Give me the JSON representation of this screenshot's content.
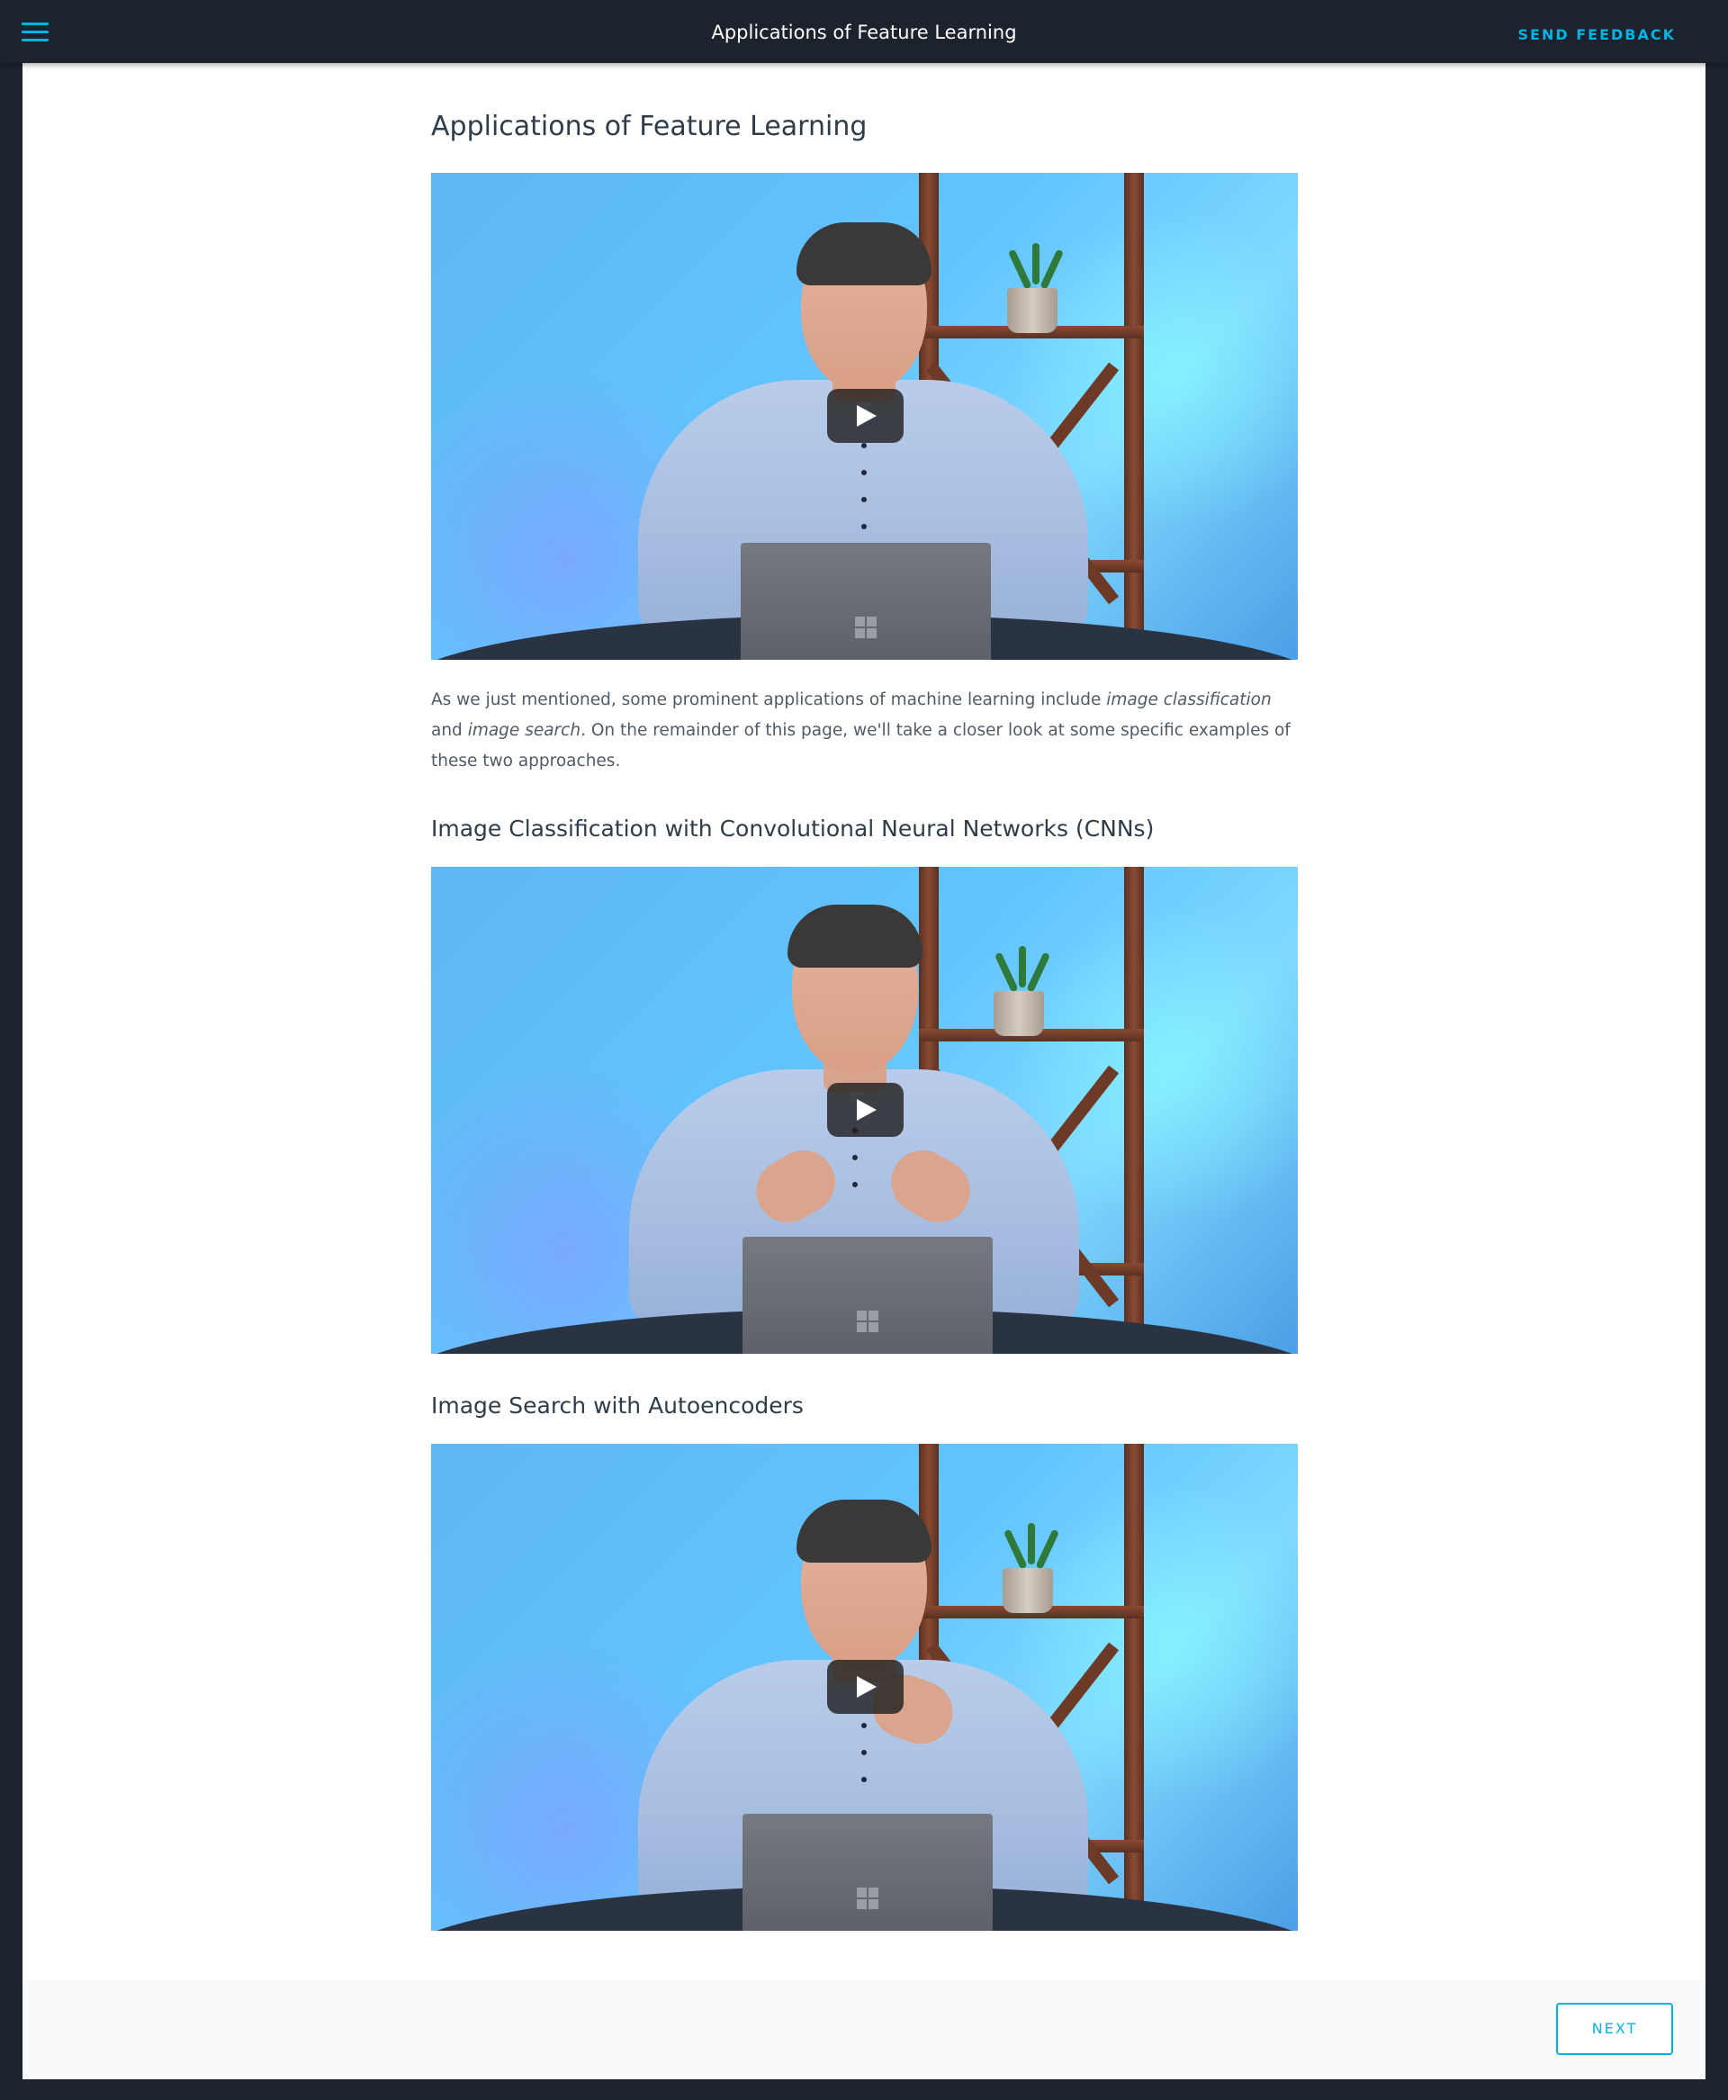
{
  "topbar": {
    "title": "Applications of Feature Learning",
    "feedback_label": "SEND FEEDBACK",
    "menu_icon": "hamburger-menu-icon"
  },
  "main": {
    "title": "Applications of Feature Learning",
    "intro_parts": [
      "As we just mentioned, some prominent applications of machine learning include ",
      "image classification",
      " and ",
      "image search",
      ". On the remainder of this page, we'll take a closer look at some specific examples of these two approaches."
    ],
    "section1_title": "Image Classification with Convolutional Neural Networks (CNNs)",
    "section2_title": "Image Search with Autoencoders"
  },
  "footer": {
    "next_label": "NEXT"
  },
  "colors": {
    "accent": "#02b3e4",
    "topbar_bg": "#1c232d",
    "heading": "#2e3d49",
    "body_text": "#4f5b66"
  }
}
